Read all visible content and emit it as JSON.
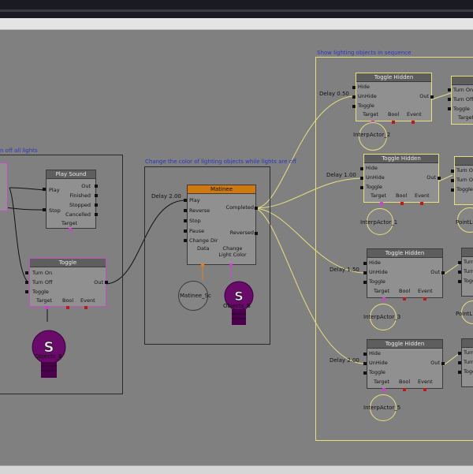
{
  "comments": {
    "turn_off": "n off all lights",
    "change_color": "Change the color of lighting objects while lights are off",
    "show_sequence": "Show lighting objects in sequence"
  },
  "play_sound": {
    "title": "Play Sound",
    "in": [
      "Play",
      "Stop"
    ],
    "out": [
      "Out",
      "Finished",
      "Stopped",
      "Cancelled"
    ],
    "bottom": [
      "Target"
    ]
  },
  "toggle": {
    "title": "Toggle",
    "in": [
      "Turn On",
      "Turn Off",
      "Toggle"
    ],
    "out": [
      "Out"
    ],
    "bottom": [
      "Target",
      "Bool",
      "Event"
    ],
    "object_label": "Objects_B"
  },
  "matinee": {
    "title": "Matinee",
    "delay": "Delay 2.00",
    "in": [
      "Play",
      "Reverse",
      "Stop",
      "Pause",
      "Change Dir"
    ],
    "out": [
      "Completed",
      "Reversed"
    ],
    "bottom": [
      "Data",
      "Change Light Color"
    ],
    "matinee_var": "Matinee_Sc",
    "object_label": "Objects_B"
  },
  "toggle_hidden": [
    {
      "title": "Toggle Hidden",
      "delay": "Delay 0.50",
      "actor": "InterpActor_2"
    },
    {
      "title": "Toggle Hidden",
      "delay": "Delay 1.00",
      "actor": "InterpActor_1"
    },
    {
      "title": "Toggle Hidden",
      "delay": "Delay 1.50",
      "actor": "InterpActor_3"
    },
    {
      "title": "Toggle Hidden",
      "delay": "Delay 2.00",
      "actor": "InterpActor_5"
    }
  ],
  "toggle_hidden_pins": {
    "in": [
      "Hide",
      "UnHide",
      "Toggle"
    ],
    "out": [
      "Out"
    ],
    "bottom": [
      "Target",
      "Bool",
      "Event"
    ]
  },
  "right_edge": {
    "pins": [
      "Turn On",
      "Turn Off",
      "Toggle"
    ],
    "target": "Target",
    "actor_a": "PointLi",
    "actor_b": "PointL"
  },
  "colors": {
    "canvas": "#808080",
    "comment_text": "#2a34c8",
    "selected_border": "#c050c0",
    "wire_yellow": "#e8e07a",
    "matinee_header": "#d07810"
  }
}
